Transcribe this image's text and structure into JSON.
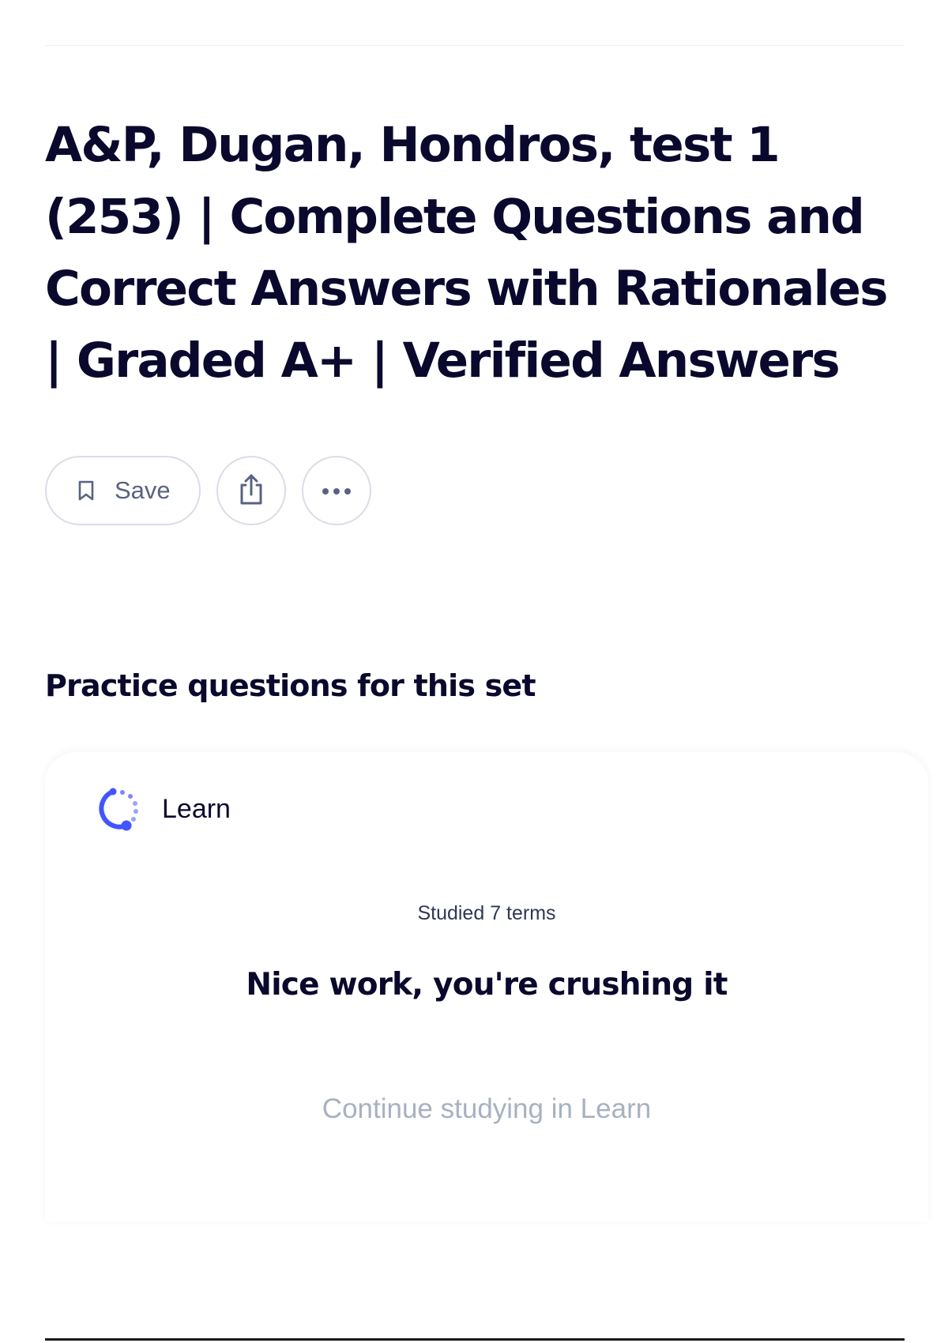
{
  "page": {
    "title": "A&P, Dugan, Hondros, test 1 (253) | Complete Questions and Correct Answers with Rationales | Graded A+ | Verified Answers"
  },
  "actions": {
    "save_label": "Save",
    "save_icon": "bookmark-icon",
    "share_icon": "share-icon",
    "more_icon": "more-horizontal-icon"
  },
  "practice": {
    "heading": "Practice questions for this set",
    "card": {
      "mode_label": "Learn",
      "mode_icon": "learn-icon",
      "studied_text": "Studied 7 terms",
      "message": "Nice work, you're crushing it",
      "cta_label": "Continue studying in Learn"
    }
  },
  "colors": {
    "text": "#0a092d",
    "muted": "#586380",
    "accent": "#4255ff",
    "cta_text": "#a8b1c2",
    "border": "#d9dde8"
  }
}
